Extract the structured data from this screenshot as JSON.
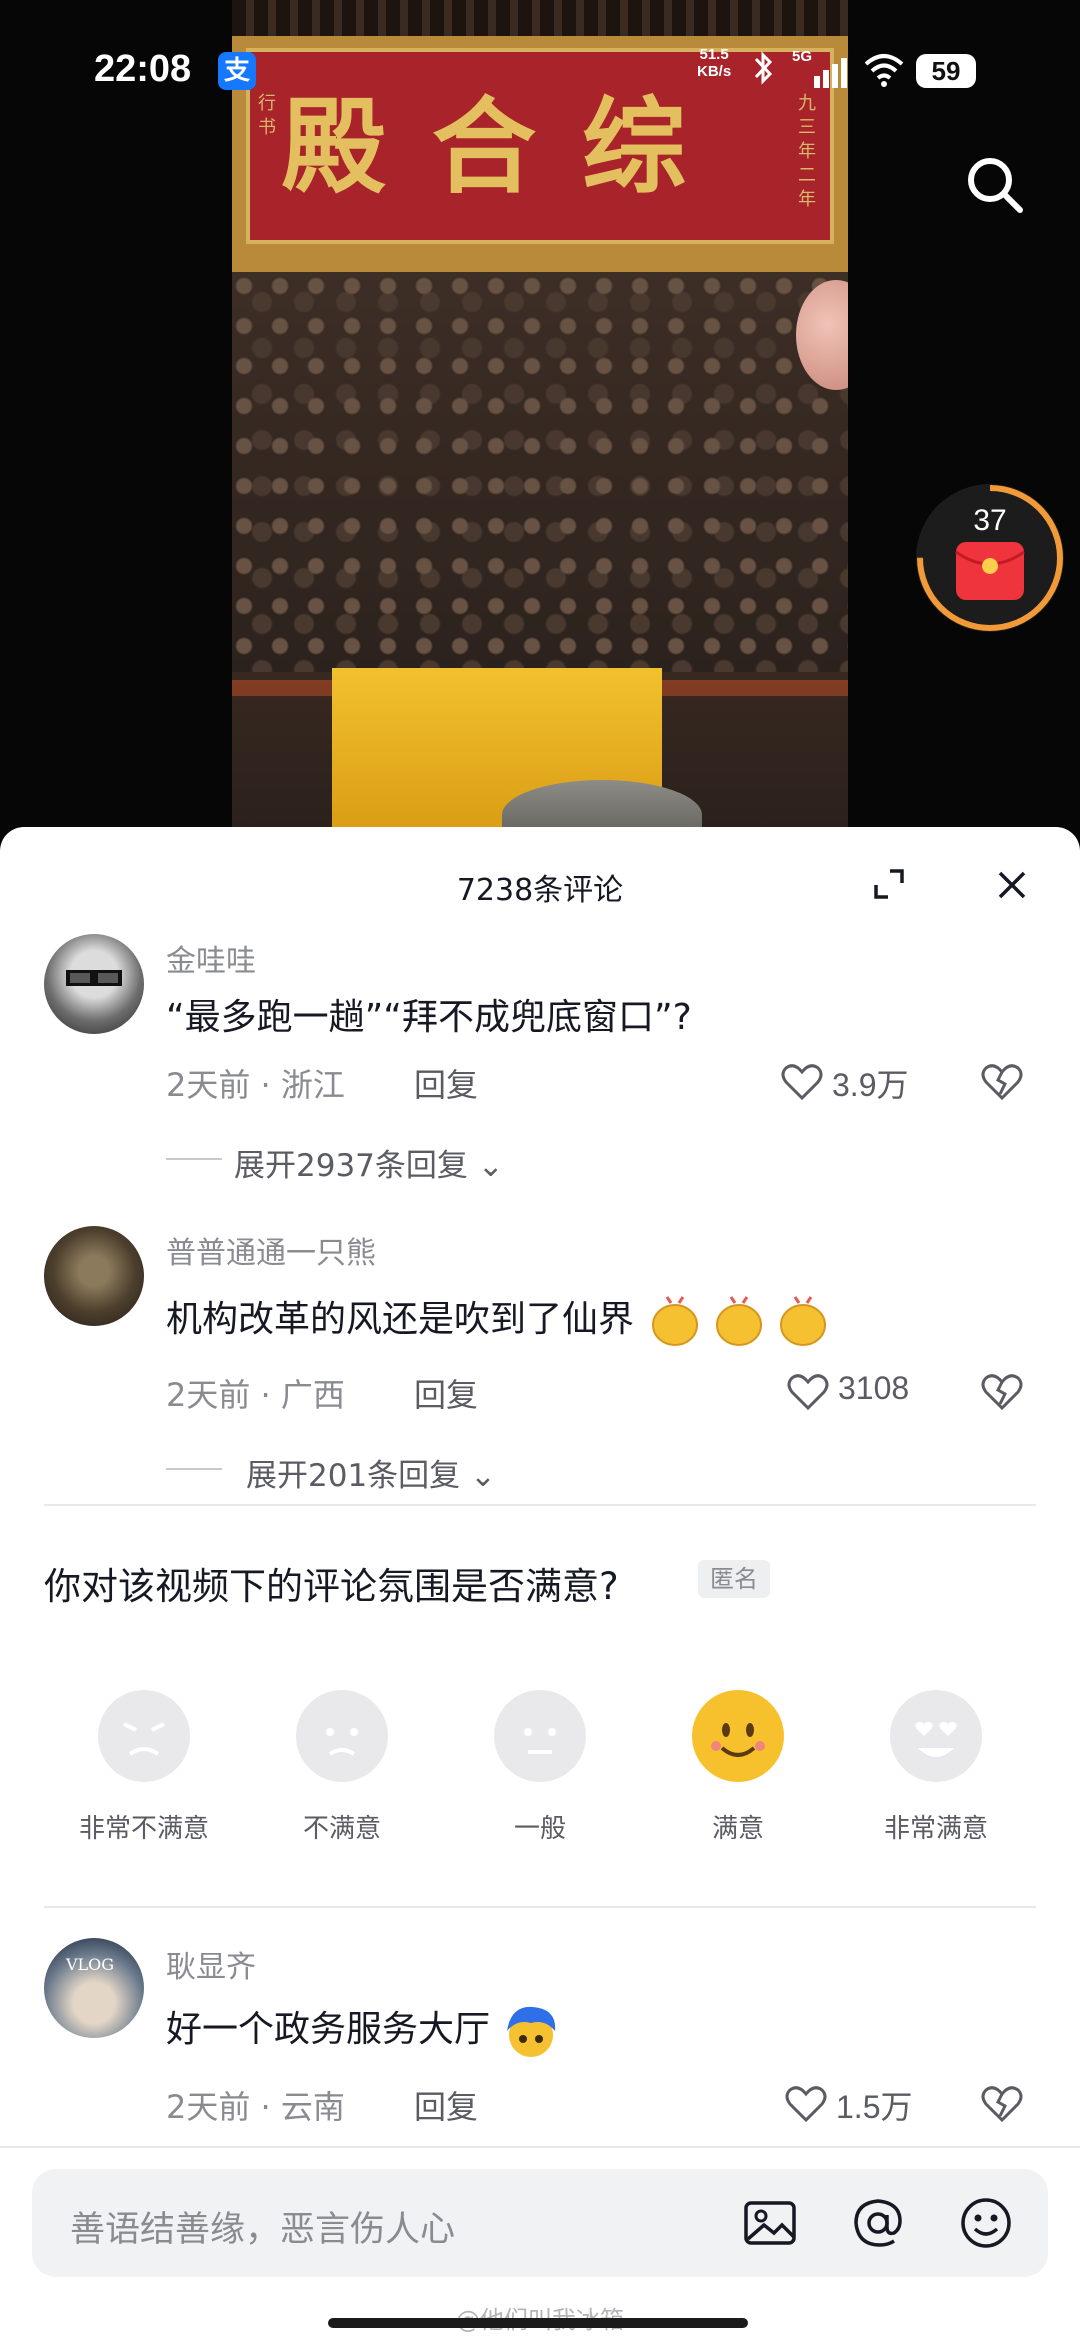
{
  "status_bar": {
    "time": "22:08",
    "alipay_icon": "支",
    "net_speed_value": "51.5",
    "net_speed_unit": "KB/s",
    "signal_label": "5G",
    "battery": "59"
  },
  "video": {
    "plaque_text": "殿合综",
    "plaque_side_left": "行书",
    "plaque_side_right": "九三年二年"
  },
  "red_packet": {
    "count": "37"
  },
  "sheet": {
    "title": "7238条评论"
  },
  "comments": [
    {
      "name": "金哇哇",
      "text": "“最多跑一趟”“拜不成兜底窗口”?",
      "time_location": "2天前 · 浙江",
      "reply": "回复",
      "likes": "3.9万",
      "expand": "展开2937条回复"
    },
    {
      "name": "普普通通一只熊",
      "text": "机构改革的风还是吹到了仙界",
      "emoji": "clapping-hands",
      "time_location": "2天前 · 广西",
      "reply": "回复",
      "likes": "3108",
      "expand": "展开201条回复"
    },
    {
      "name": "耿显齐",
      "text": "好一个政务服务大厅",
      "emoji": "blue-hair-face",
      "time_location": "2天前 · 云南",
      "reply": "回复",
      "likes": "1.5万",
      "avatar_text": "VLOG"
    }
  ],
  "survey": {
    "question": "你对该视频下的评论氛围是否满意?",
    "anon": "匿名",
    "options": [
      "非常不满意",
      "不满意",
      "一般",
      "满意",
      "非常满意"
    ],
    "selected": "满意"
  },
  "input": {
    "placeholder": "善语结善缘，恶言伤人心"
  },
  "watermark": "@他们叫我冰箱"
}
